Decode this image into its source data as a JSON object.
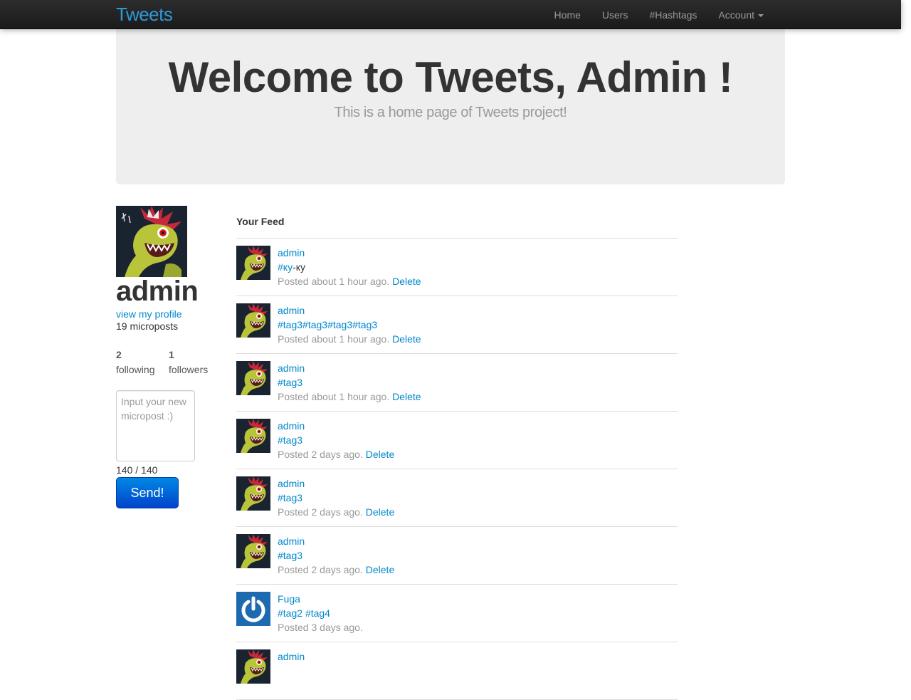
{
  "nav": {
    "brand": "Tweets",
    "items": [
      {
        "label": "Home"
      },
      {
        "label": "Users"
      },
      {
        "label": "#Hashtags"
      },
      {
        "label": "Account"
      }
    ]
  },
  "hero": {
    "title": "Welcome to Tweets, Admin !",
    "subtitle": "This is a home page of Tweets project!"
  },
  "sidebar": {
    "name": "admin",
    "profile_link": "view my profile",
    "microposts": "19 microposts",
    "following_count": "2",
    "following_label": "following",
    "followers_count": "1",
    "followers_label": "followers",
    "input_placeholder": "Input your new micropost :)",
    "char_count": "140 / 140",
    "send_label": "Send!"
  },
  "feed": {
    "title": "Your Feed",
    "items": [
      {
        "user": "admin",
        "content": [
          {
            "text": "#ку",
            "tag": true
          },
          {
            "text": "-ку",
            "tag": false
          }
        ],
        "posted": "Posted about 1 hour ago.",
        "delete": "Delete",
        "avatar": "dragon"
      },
      {
        "user": "admin",
        "content": [
          {
            "text": "#tag3#tag3#tag3#tag3",
            "tag": true
          }
        ],
        "posted": "Posted about 1 hour ago.",
        "delete": "Delete",
        "avatar": "dragon"
      },
      {
        "user": "admin",
        "content": [
          {
            "text": "#tag3",
            "tag": true
          }
        ],
        "posted": "Posted about 1 hour ago.",
        "delete": "Delete",
        "avatar": "dragon"
      },
      {
        "user": "admin",
        "content": [
          {
            "text": "#tag3",
            "tag": true
          }
        ],
        "posted": "Posted 2 days ago.",
        "delete": "Delete",
        "avatar": "dragon"
      },
      {
        "user": "admin",
        "content": [
          {
            "text": "#tag3",
            "tag": true
          }
        ],
        "posted": "Posted 2 days ago.",
        "delete": "Delete",
        "avatar": "dragon"
      },
      {
        "user": "admin",
        "content": [
          {
            "text": "#tag3",
            "tag": true
          }
        ],
        "posted": "Posted 2 days ago.",
        "delete": "Delete",
        "avatar": "dragon"
      },
      {
        "user": "Fuga",
        "content": [
          {
            "text": "#tag2",
            "tag": true
          },
          {
            "text": " ",
            "tag": false
          },
          {
            "text": "#tag4",
            "tag": true
          }
        ],
        "posted": "Posted 3 days ago.",
        "delete": "",
        "avatar": "gravatar"
      },
      {
        "user": "admin",
        "content": [],
        "posted": "",
        "delete": "",
        "avatar": "dragon"
      }
    ]
  },
  "colors": {
    "link": "#0088cc",
    "navbar": "#1b1b1b",
    "brand": "#2f9ad8",
    "hero_bg": "#eeeeee",
    "button": "#0044cc",
    "gravatar": "#1e6ab0"
  }
}
